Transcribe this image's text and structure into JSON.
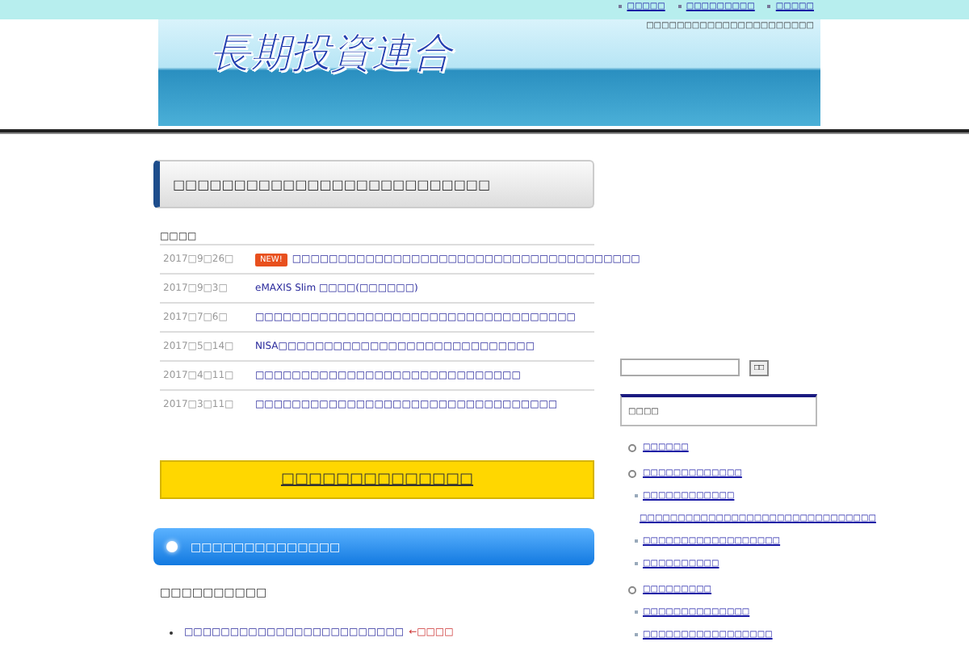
{
  "top_links": [
    "□□□□□",
    "□□□□□□□□□",
    "□□□□□"
  ],
  "tagline": "□□□□□□□□□□□□□□□□□□□□□□",
  "logo": "長期投資連合",
  "section_heading": "□□□□□□□□□□□□□□□□□□□□□□□□□□",
  "news": {
    "label": "□□□□",
    "items": [
      {
        "date": "2017□9□26□",
        "badge": "NEW!",
        "title": "□□□□□□□□□□□□□□□□□□□□□□□□□□□□□□□□□□□□□□"
      },
      {
        "date": "2017□9□3□",
        "title": "eMAXIS Slim □□□□(□□□□□□)"
      },
      {
        "date": "2017□7□6□",
        "title": "□□□□□□□□□□□□□□□□□□□□□□□□□□□□□□□□□□□"
      },
      {
        "date": "2017□5□14□",
        "title": "NISA□□□□□□□□□□□□□□□□□□□□□□□□□□□□"
      },
      {
        "date": "2017□4□11□",
        "title": "□□□□□□□□□□□□□□□□□□□□□□□□□□□□□"
      },
      {
        "date": "2017□3□11□",
        "title": "□□□□□□□□□□□□□□□□□□□□□□□□□□□□□□□□□"
      }
    ]
  },
  "banner_link": "□□□□□□□□□□□□□□",
  "blue_heading": "□□□□□□□□□□□□□□",
  "subheading": "□□□□□□□□□□",
  "bullets": [
    {
      "text": "□□□□□□□□□□□□□□□□□□□□□□□□",
      "note": "←□□□□"
    }
  ],
  "search": {
    "button": "□□"
  },
  "widget": {
    "title": "□□□□",
    "items": [
      {
        "label": "□□□□□□"
      },
      {
        "label": "□□□□□□□□□□□□□",
        "children": [
          {
            "label": "□□□□□□□□□□□□"
          },
          {
            "label": "□□□□□□□□□□□□□□□□□□□□□□□□□□□□□□□"
          },
          {
            "label": "□□□□□□□□□□□□□□□□□□"
          },
          {
            "label": "□□□□□□□□□□"
          }
        ]
      },
      {
        "label": "□□□□□□□□□",
        "children": [
          {
            "label": "□□□□□□□□□□□□□□"
          },
          {
            "label": "□□□□□□□□□□□□□□□□□"
          }
        ]
      }
    ]
  }
}
